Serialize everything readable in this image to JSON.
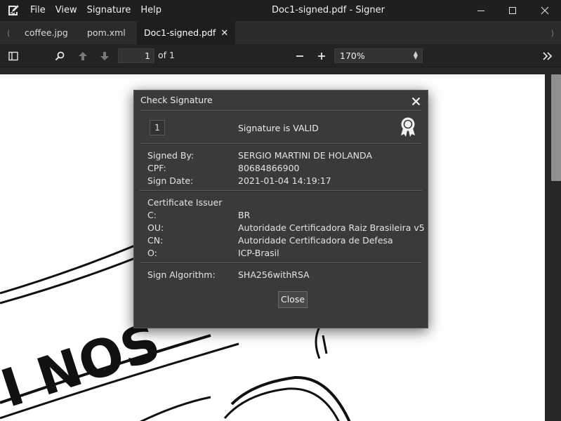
{
  "window": {
    "title": "Doc1-signed.pdf - Signer",
    "logo_icon": "signer-logo-icon",
    "controls": [
      "minimize-icon",
      "maximize-icon",
      "close-icon"
    ]
  },
  "menu": {
    "items": [
      "File",
      "View",
      "Signature",
      "Help"
    ]
  },
  "tabs": {
    "items": [
      {
        "label": "coffee.jpg",
        "active": false
      },
      {
        "label": "pom.xml",
        "active": false
      },
      {
        "label": "Doc1-signed.pdf",
        "active": true,
        "close": "✕"
      }
    ],
    "scroll_left": "⟨",
    "scroll_right": "⟩"
  },
  "toolbar": {
    "page_value": "1",
    "page_of": "of 1",
    "zoom_value": "170%",
    "icons": [
      "sidebar-toggle-icon",
      "search-icon",
      "prev-page-icon",
      "next-page-icon",
      "zoom-out-icon",
      "zoom-in-icon",
      "more-tools-icon"
    ]
  },
  "dialog": {
    "title": "Check Signature",
    "signature_index": "1",
    "status": "Signature is VALID",
    "status_icon": "certificate-badge-icon",
    "signer": {
      "signed_by_label": "Signed By:",
      "signed_by_value": "SERGIO MARTINI DE HOLANDA",
      "cpf_label": "CPF:",
      "cpf_value": "80684866900",
      "sign_date_label": "Sign Date:",
      "sign_date_value": "2021-01-04 14:19:17"
    },
    "issuer": {
      "heading": "Certificate Issuer",
      "c_label": "C:",
      "c_value": "BR",
      "ou_label": "OU:",
      "ou_value": "Autoridade Certificadora Raiz Brasileira v5",
      "cn_label": "CN:",
      "cn_value": "Autoridade Certificadora de Defesa",
      "o_label": "O:",
      "o_value": "ICP-Brasil"
    },
    "algorithm": {
      "label": "Sign Algorithm:",
      "value": "SHA256withRSA"
    },
    "close_label": "Close"
  },
  "document": {
    "visible_text": "I NOS"
  },
  "colors": {
    "chrome_bg": "#1f1f1f",
    "tabbar_bg": "#2b2b2b",
    "dialog_bg": "#3a3a3a",
    "page_bg": "#ffffff"
  }
}
